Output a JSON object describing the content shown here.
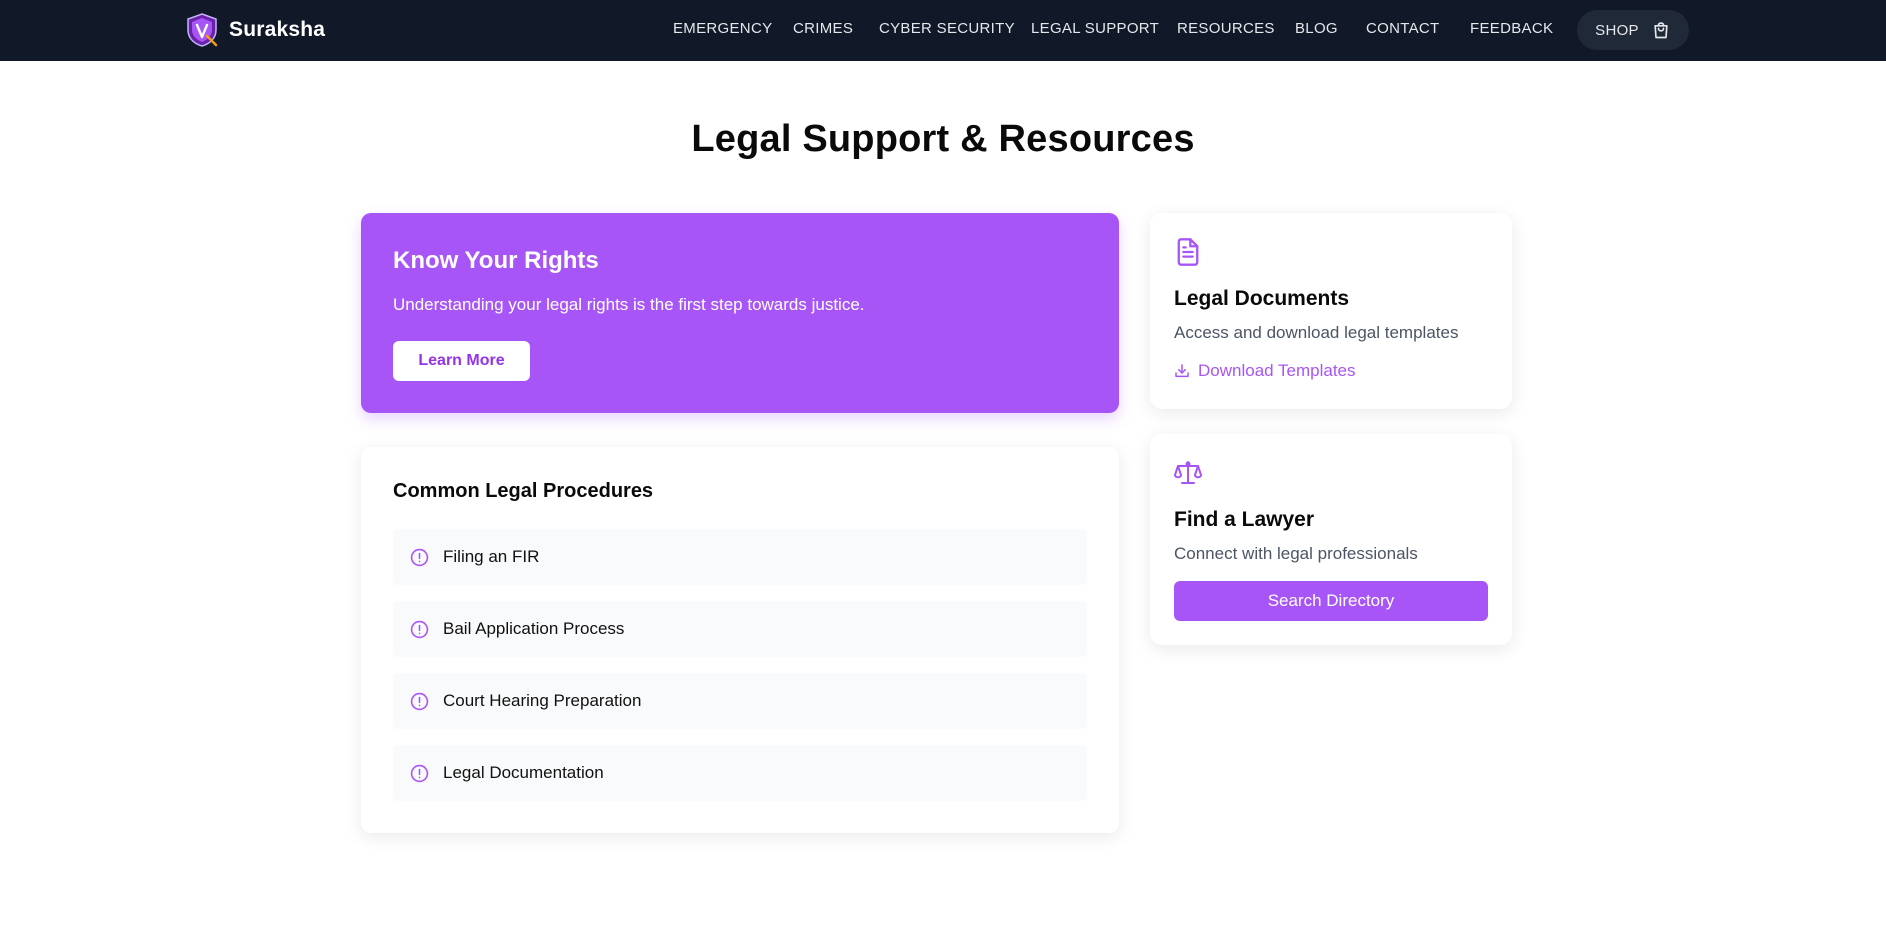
{
  "header": {
    "brand": "Suraksha",
    "nav": [
      {
        "label": "EMERGENCY"
      },
      {
        "label": "CRIMES"
      },
      {
        "label": "CYBER SECURITY"
      },
      {
        "label": "LEGAL SUPPORT"
      },
      {
        "label": "RESOURCES"
      },
      {
        "label": "BLOG"
      },
      {
        "label": "CONTACT"
      },
      {
        "label": "FEEDBACK"
      }
    ],
    "shop": {
      "label": "SHOP",
      "icon": "shopping-bag-icon"
    }
  },
  "page": {
    "title": "Legal Support & Resources"
  },
  "hero": {
    "title": "Know Your Rights",
    "text": "Understanding your legal rights is the first step towards justice.",
    "button": "Learn More"
  },
  "procedures": {
    "title": "Common Legal Procedures",
    "items": [
      {
        "label": "Filing an FIR",
        "icon": "alert-circle-icon"
      },
      {
        "label": "Bail Application Process",
        "icon": "alert-circle-icon"
      },
      {
        "label": "Court Hearing Preparation",
        "icon": "alert-circle-icon"
      },
      {
        "label": "Legal Documentation",
        "icon": "alert-circle-icon"
      }
    ]
  },
  "documents": {
    "icon": "file-text-icon",
    "title": "Legal Documents",
    "text": "Access and download legal templates",
    "link": "Download Templates",
    "link_icon": "download-icon"
  },
  "lawyer": {
    "icon": "scale-icon",
    "title": "Find a Lawyer",
    "text": "Connect with legal professionals",
    "button": "Search Directory"
  },
  "colors": {
    "accent": "#a855f7",
    "navbar": "#111827",
    "procedure_bg": "#f9fafb"
  }
}
